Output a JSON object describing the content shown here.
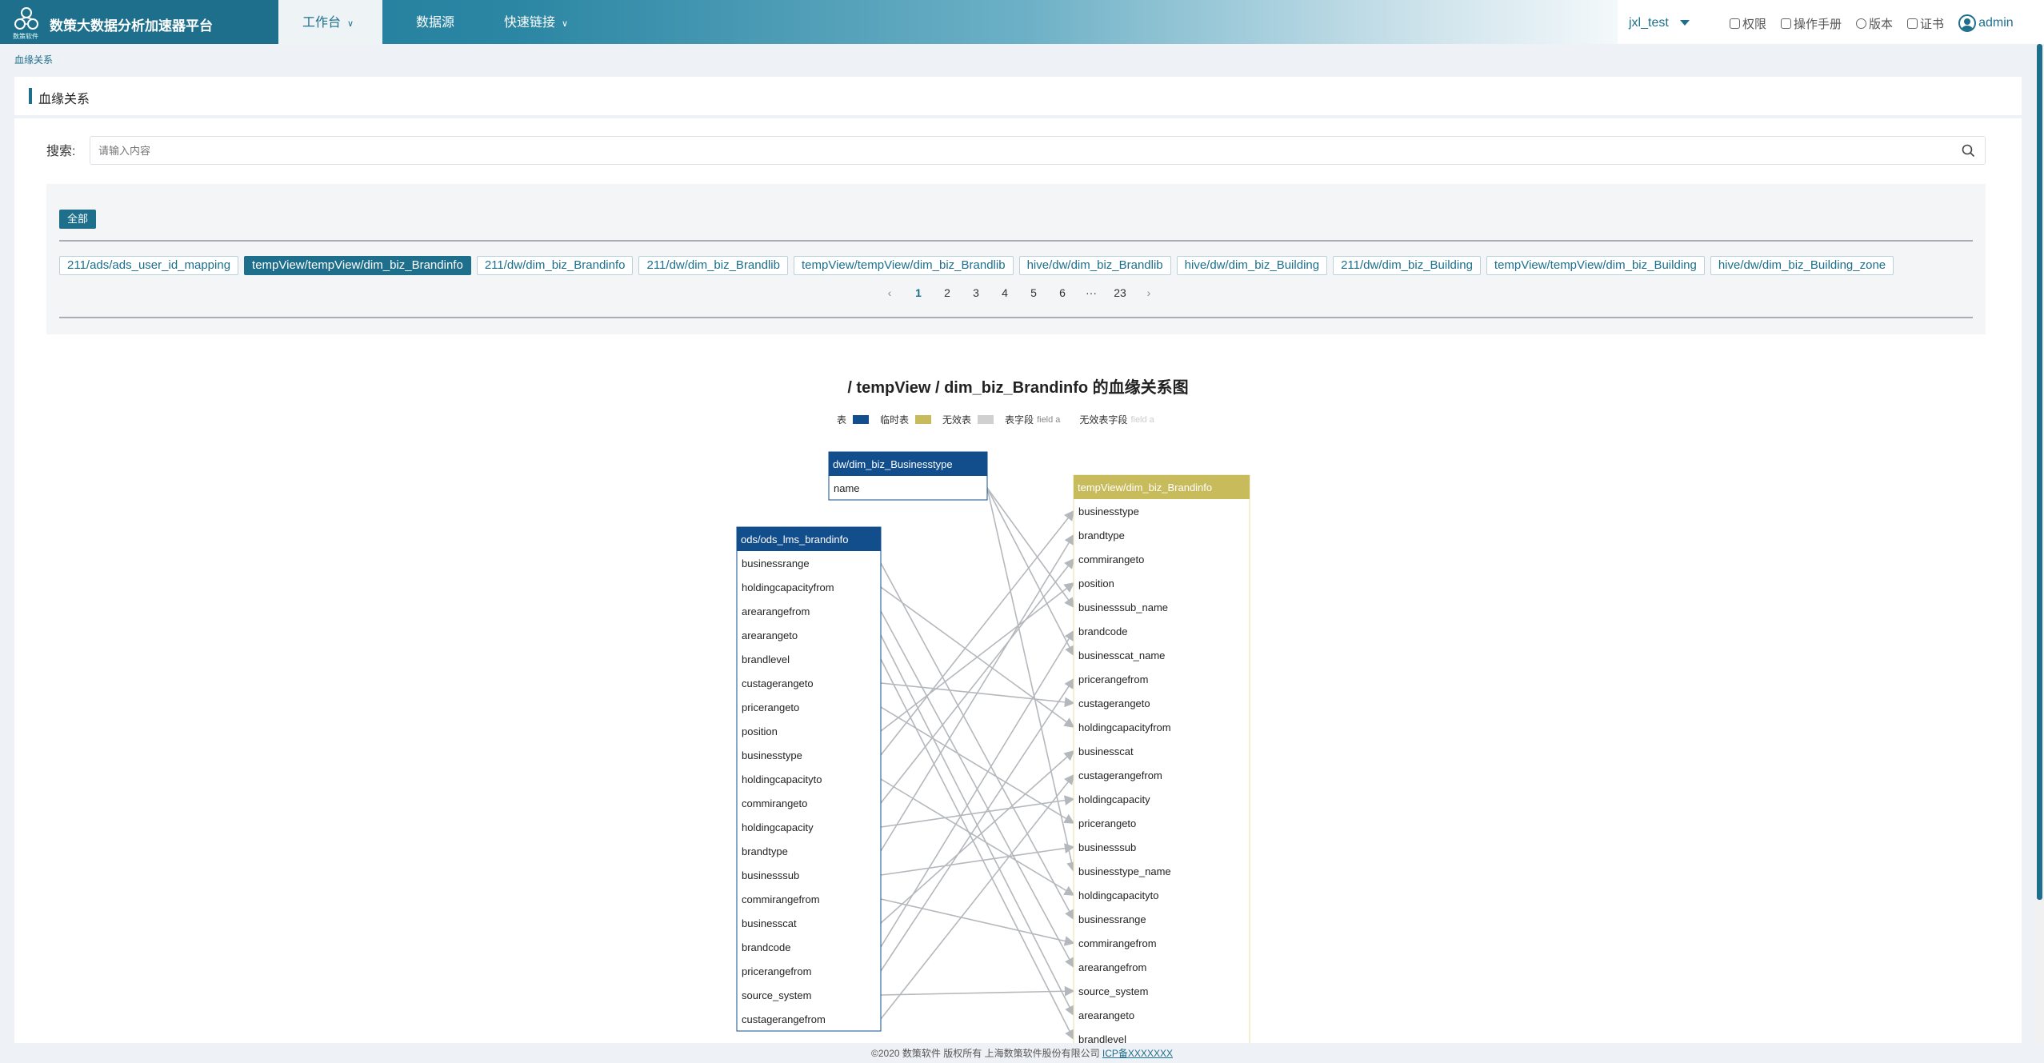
{
  "header": {
    "app_title": "数策大数据分析加速器平台",
    "logo_caption": "数策软件",
    "nav": [
      {
        "label": "工作台",
        "has_caret": true,
        "active": true
      },
      {
        "label": "数据源",
        "has_caret": false,
        "active": false
      },
      {
        "label": "快速链接",
        "has_caret": true,
        "active": false
      }
    ],
    "user": "jxl_test",
    "links": [
      {
        "label": "权限",
        "icon": "lock-icon"
      },
      {
        "label": "操作手册",
        "icon": "document-icon"
      },
      {
        "label": "版本",
        "icon": "version-icon"
      },
      {
        "label": "证书",
        "icon": "certificate-icon"
      }
    ],
    "admin": "admin"
  },
  "breadcrumb": "血缘关系",
  "page_title": "血缘关系",
  "search": {
    "label": "搜索:",
    "placeholder": "请输入内容"
  },
  "filter": {
    "all_label": "全部",
    "tags": [
      {
        "label": "211/ads/ads_user_id_mapping",
        "active": false
      },
      {
        "label": "tempView/tempView/dim_biz_Brandinfo",
        "active": true
      },
      {
        "label": "211/dw/dim_biz_Brandinfo",
        "active": false
      },
      {
        "label": "211/dw/dim_biz_Brandlib",
        "active": false
      },
      {
        "label": "tempView/tempView/dim_biz_Brandlib",
        "active": false
      },
      {
        "label": "hive/dw/dim_biz_Brandlib",
        "active": false
      },
      {
        "label": "hive/dw/dim_biz_Building",
        "active": false
      },
      {
        "label": "211/dw/dim_biz_Building",
        "active": false
      },
      {
        "label": "tempView/tempView/dim_biz_Building",
        "active": false
      },
      {
        "label": "hive/dw/dim_biz_Building_zone",
        "active": false
      }
    ],
    "pager": [
      "1",
      "2",
      "3",
      "4",
      "5",
      "6",
      "···",
      "23"
    ],
    "current_page": "1"
  },
  "graph": {
    "title": "/ tempView / dim_biz_Brandinfo 的血缘关系图",
    "legend": [
      {
        "label": "表",
        "color": "#124e8c"
      },
      {
        "label": "临时表",
        "color": "#c7bb5b"
      },
      {
        "label": "无效表",
        "color": "#d0d0d0"
      },
      {
        "label": "表字段",
        "sample": "field a",
        "sample_color": "#888888"
      },
      {
        "label": "无效表字段",
        "sample": "field a",
        "sample_color": "#cccccc"
      }
    ],
    "tables": [
      {
        "id": "biz_type",
        "name": "dw/dim_biz_Businesstype",
        "kind": "table",
        "fields": [
          "name"
        ]
      },
      {
        "id": "ods",
        "name": "ods/ods_lms_brandinfo",
        "kind": "table",
        "fields": [
          "businessrange",
          "holdingcapacityfrom",
          "arearangefrom",
          "arearangeto",
          "brandlevel",
          "custagerangeto",
          "pricerangeto",
          "position",
          "businesstype",
          "holdingcapacityto",
          "commirangeto",
          "holdingcapacity",
          "brandtype",
          "businesssub",
          "commirangefrom",
          "businesscat",
          "brandcode",
          "pricerangefrom",
          "source_system",
          "custagerangefrom"
        ]
      },
      {
        "id": "target",
        "name": "tempView/dim_biz_Brandinfo",
        "kind": "temp",
        "fields": [
          "businesstype",
          "brandtype",
          "commirangeto",
          "position",
          "businesssub_name",
          "brandcode",
          "businesscat_name",
          "pricerangefrom",
          "custagerangeto",
          "holdingcapacityfrom",
          "businesscat",
          "custagerangefrom",
          "holdingcapacity",
          "pricerangeto",
          "businesssub",
          "businesstype_name",
          "holdingcapacityto",
          "businessrange",
          "commirangefrom",
          "arearangefrom",
          "source_system",
          "arearangeto",
          "brandlevel"
        ]
      }
    ],
    "edges": [
      [
        "biz_type",
        "name",
        "target",
        "businesssub_name"
      ],
      [
        "biz_type",
        "name",
        "target",
        "businesscat_name"
      ],
      [
        "biz_type",
        "name",
        "target",
        "businesstype_name"
      ],
      [
        "ods",
        "businessrange",
        "target",
        "businessrange"
      ],
      [
        "ods",
        "holdingcapacityfrom",
        "target",
        "holdingcapacityfrom"
      ],
      [
        "ods",
        "arearangefrom",
        "target",
        "arearangefrom"
      ],
      [
        "ods",
        "arearangeto",
        "target",
        "arearangeto"
      ],
      [
        "ods",
        "brandlevel",
        "target",
        "brandlevel"
      ],
      [
        "ods",
        "custagerangeto",
        "target",
        "custagerangeto"
      ],
      [
        "ods",
        "pricerangeto",
        "target",
        "pricerangeto"
      ],
      [
        "ods",
        "position",
        "target",
        "position"
      ],
      [
        "ods",
        "businesstype",
        "target",
        "businesstype"
      ],
      [
        "ods",
        "holdingcapacityto",
        "target",
        "holdingcapacityto"
      ],
      [
        "ods",
        "commirangeto",
        "target",
        "commirangeto"
      ],
      [
        "ods",
        "holdingcapacity",
        "target",
        "holdingcapacity"
      ],
      [
        "ods",
        "brandtype",
        "target",
        "brandtype"
      ],
      [
        "ods",
        "businesssub",
        "target",
        "businesssub"
      ],
      [
        "ods",
        "commirangefrom",
        "target",
        "commirangefrom"
      ],
      [
        "ods",
        "businesscat",
        "target",
        "businesscat"
      ],
      [
        "ods",
        "brandcode",
        "target",
        "brandcode"
      ],
      [
        "ods",
        "pricerangefrom",
        "target",
        "pricerangefrom"
      ],
      [
        "ods",
        "source_system",
        "target",
        "source_system"
      ],
      [
        "ods",
        "custagerangefrom",
        "target",
        "custagerangefrom"
      ]
    ]
  },
  "footer": {
    "text": "©2020 数策软件 版权所有 上海数策软件股份有限公司",
    "icp": "ICP备XXXXXXX"
  }
}
